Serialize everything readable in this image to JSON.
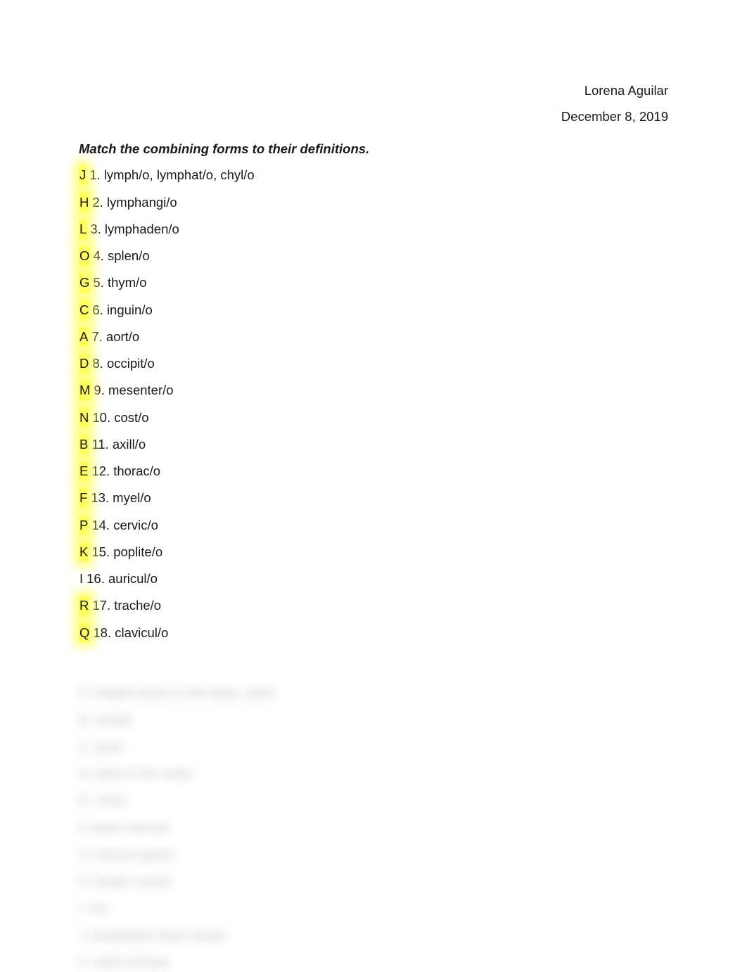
{
  "header": {
    "author": "Lorena Aguilar",
    "date": "December 8, 2019"
  },
  "instruction": "Match the combining forms to their definitions.",
  "questions": [
    {
      "answer": "J",
      "highlighted": true,
      "num": "1.",
      "term": "lymph/o, lymphat/o, chyl/o"
    },
    {
      "answer": "H",
      "highlighted": true,
      "num": "2.",
      "term": "lymphangi/o"
    },
    {
      "answer": "L",
      "highlighted": true,
      "num": "3.",
      "term": "lymphaden/o"
    },
    {
      "answer": "O",
      "highlighted": true,
      "num": "4.",
      "term": "splen/o"
    },
    {
      "answer": "G",
      "highlighted": true,
      "num": "5.",
      "term": "thym/o"
    },
    {
      "answer": "C",
      "highlighted": true,
      "num": "6.",
      "term": "inguin/o"
    },
    {
      "answer": "A",
      "highlighted": true,
      "num": "7.",
      "term": "aort/o"
    },
    {
      "answer": "D",
      "highlighted": true,
      "num": "8.",
      "term": "occipit/o"
    },
    {
      "answer": "M",
      "highlighted": true,
      "num": "9.",
      "term": "mesenter/o"
    },
    {
      "answer": "N",
      "highlighted": true,
      "num": "10.",
      "term": "cost/o"
    },
    {
      "answer": "B",
      "highlighted": true,
      "num": "11.",
      "term": "axill/o"
    },
    {
      "answer": "E",
      "highlighted": true,
      "num": "12.",
      "term": "thorac/o"
    },
    {
      "answer": "F",
      "highlighted": true,
      "num": "13.",
      "term": "myel/o"
    },
    {
      "answer": "P",
      "highlighted": true,
      "num": "14.",
      "term": "cervic/o"
    },
    {
      "answer": "K",
      "highlighted": true,
      "num": "15.",
      "term": "poplite/o"
    },
    {
      "answer": "I",
      "highlighted": false,
      "num": "16.",
      "term": "auricul/o"
    },
    {
      "answer": "R",
      "highlighted": true,
      "num": "17.",
      "term": "trache/o"
    },
    {
      "answer": "Q",
      "highlighted": true,
      "num": "18.",
      "term": "clavicul/o"
    }
  ],
  "blurred": [
    "A. largest artery in the body; aorta",
    "B. armpit",
    "C. groin",
    "D. back of the head",
    "E. chest",
    "F. bone marrow",
    "G. thymus gland",
    "H. lymph vessel",
    "I. ear",
    "J. lymph(atic) fluid; lymph",
    "K. back of knee"
  ]
}
